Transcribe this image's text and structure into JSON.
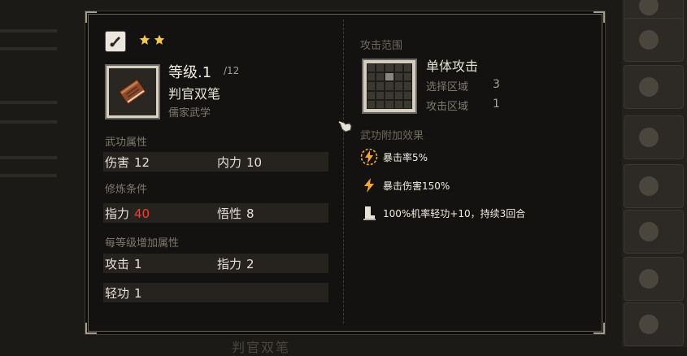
{
  "background": {
    "bottom_title": "判官双笔"
  },
  "skill": {
    "stars": 2,
    "level_label": "等级.1",
    "level_max": "/12",
    "name": "判官双笔",
    "school": "儒家武学"
  },
  "sections": {
    "attributes_title": "武功属性",
    "requirements_title": "修炼条件",
    "per_level_title": "每等级增加属性"
  },
  "attributes": {
    "damage": {
      "label": "伤害",
      "value": "12"
    },
    "inner_force": {
      "label": "内力",
      "value": "10"
    }
  },
  "requirements": {
    "strength": {
      "label": "指力",
      "value": "40",
      "color": "#ff3b2e"
    },
    "insight": {
      "label": "悟性",
      "value": "8"
    }
  },
  "per_level": {
    "attack": {
      "label": "攻击",
      "value": "1"
    },
    "strength": {
      "label": "指力",
      "value": "2"
    },
    "agility": {
      "label": "轻功",
      "value": "1"
    }
  },
  "range": {
    "title": "攻击范围",
    "attack_type": "单体攻击",
    "select_area_label": "选择区域",
    "select_area_value": "3",
    "attack_area_label": "攻击区域",
    "attack_area_value": "1"
  },
  "effects": {
    "title": "武功附加效果",
    "items": [
      {
        "icon": "crit-rate-icon",
        "text": "暴击率5%"
      },
      {
        "icon": "crit-damage-icon",
        "text": "暴击伤害150%"
      },
      {
        "icon": "boot-icon",
        "text": "100%机率轻功+10，持续3回合"
      }
    ]
  },
  "colors": {
    "star": "#f2c94c",
    "lightning": "#f2a63a",
    "warning_value": "#ff3b2e"
  }
}
